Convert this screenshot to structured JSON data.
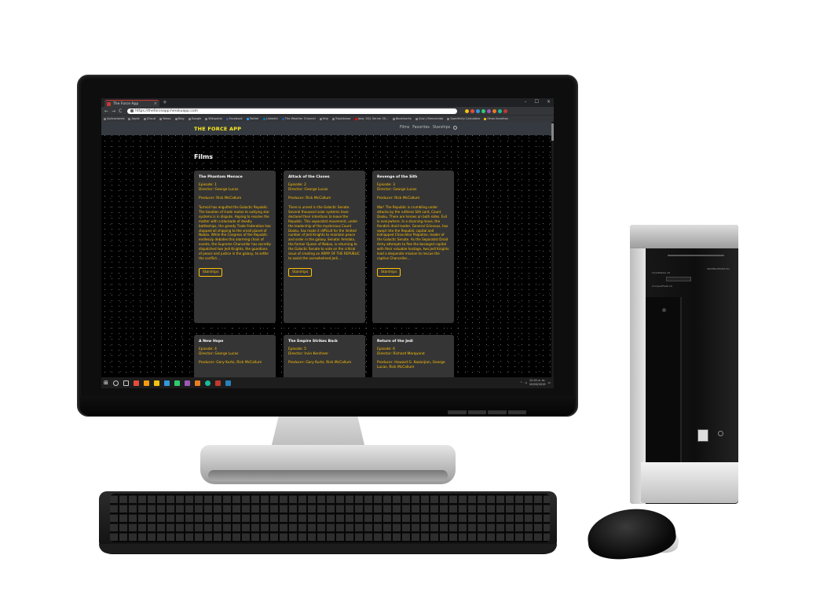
{
  "browser": {
    "tab_title": "The Force App",
    "tab_close": "×",
    "new_tab": "+",
    "window_controls": [
      "–",
      "☐",
      "×"
    ],
    "nav": {
      "back": "←",
      "forward": "→",
      "reload": "C"
    },
    "url": "https://theforceapp.herokuapp.com",
    "bookmarks": [
      "Aplicaciones",
      "Apple",
      "iCloud",
      "Yahoo",
      "Bing",
      "Google",
      "Wikipedia",
      "Facebook",
      "Twitter",
      "LinkedIn",
      "The Weather Channel",
      "Yelp",
      "TripAdvisor",
      "Java, SQL Server 20...",
      "Bookmarks",
      "Quiz | Bienvenido",
      "Specificity Calculator",
      "Otros favoritos"
    ]
  },
  "app": {
    "brand": "THE FORCE APP",
    "nav": {
      "films": "Films",
      "favorites": "Favorites",
      "starships": "Starships"
    },
    "heading": "Films",
    "button_label": "Starships",
    "films": [
      {
        "title": "The Phantom Menace",
        "episode": "Episode: 1",
        "director": "Director: George Lucas",
        "producer": "Producer: Rick McCallum",
        "crawl": "Turmoil has engulfed the Galactic Republic. The taxation of trade routes to outlying star systems is in dispute. Hoping to resolve the matter with a blockade of deadly battleships, the greedy Trade Federation has stopped all shipping to the small planet of Naboo. While the Congress of the Republic endlessly debates this alarming chain of events, the Supreme Chancellor has secretly dispatched two Jedi Knights, the guardians of peace and justice in the galaxy, to settle the conflict...."
      },
      {
        "title": "Attack of the Clones",
        "episode": "Episode: 2",
        "director": "Director: George Lucas",
        "producer": "Producer: Rick McCallum",
        "crawl": "There is unrest in the Galactic Senate. Several thousand solar systems have declared their intentions to leave the Republic. This separatist movement, under the leadership of the mysterious Count Dooku, has made it difficult for the limited number of Jedi Knights to maintain peace and order in the galaxy. Senator Amidala, the former Queen of Naboo, is returning to the Galactic Senate to vote on the critical issue of creating an ARMY OF THE REPUBLIC to assist the overwhelmed Jedi...."
      },
      {
        "title": "Revenge of the Sith",
        "episode": "Episode: 3",
        "director": "Director: George Lucas",
        "producer": "Producer: Rick McCallum",
        "crawl": "War! The Republic is crumbling under attacks by the ruthless Sith Lord, Count Dooku. There are heroes on both sides. Evil is everywhere. In a stunning move, the fiendish droid leader, General Grievous, has swept into the Republic capital and kidnapped Chancellor Palpatine, leader of the Galactic Senate. As the Separatist Droid Army attempts to flee the besieged capital with their valuable hostage, two Jedi Knights lead a desperate mission to rescue the captive Chancellor...."
      },
      {
        "title": "A New Hope",
        "episode": "Episode: 4",
        "director": "Director: George Lucas",
        "producer": "Producer: Gary Kurtz, Rick McCallum"
      },
      {
        "title": "The Empire Strikes Back",
        "episode": "Episode: 5",
        "director": "Director: Irvin Kershner",
        "producer": "Producer: Gary Kurtz, Rick McCallum"
      },
      {
        "title": "Return of the Jedi",
        "episode": "Episode: 6",
        "director": "Director: Richard Marquand",
        "producer": "Producer: Howard G. Kazanjian, George Lucas, Rick McCallum"
      }
    ]
  },
  "taskbar": {
    "start": "⊞",
    "time": "12:41 a. m.",
    "date": "20/03/2019",
    "icon_colors": [
      "#e74c3c",
      "#f39c12",
      "#f1c40f",
      "#3498db",
      "#2ecc71",
      "#9b59b6",
      "#e67e22",
      "#1abc9c",
      "#c0392b",
      "#2980b9",
      "#f1c40f",
      "#3498db"
    ]
  },
  "tower": {
    "card_reader_label": "SmartMedia xD",
    "reader_right_label": "SD/MMC/MS/MS Pro",
    "cf_label": "CompactFlash I/II"
  },
  "colors": {
    "accent": "#ffc107",
    "brand": "#ffe81f",
    "card_bg": "#353535",
    "navbar": "#343a40"
  }
}
